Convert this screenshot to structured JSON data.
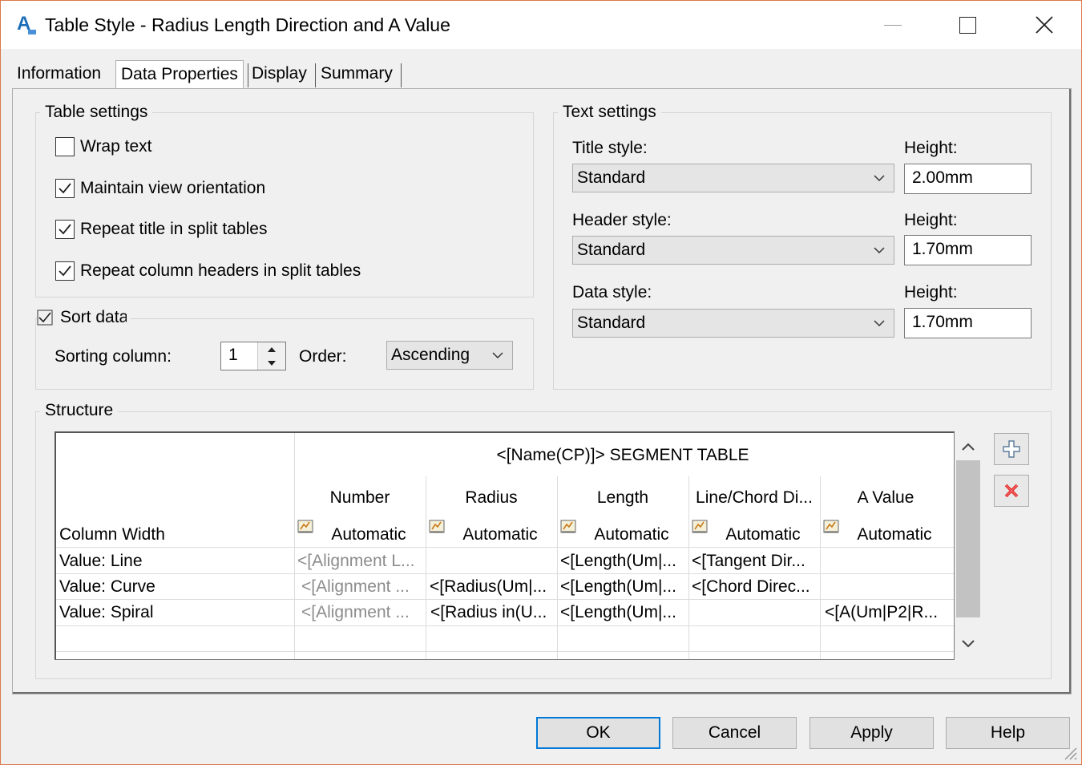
{
  "window": {
    "title": "Table Style - Radius Length Direction and A Value",
    "app_icon_letter": "A",
    "accent_border": "#d9784a"
  },
  "tabs": [
    {
      "label": "Information",
      "active": false
    },
    {
      "label": "Data Properties",
      "active": true
    },
    {
      "label": "Display",
      "active": false
    },
    {
      "label": "Summary",
      "active": false
    }
  ],
  "table_settings": {
    "label": "Table settings",
    "wrap_text": {
      "label": "Wrap text",
      "checked": false
    },
    "maintain_view": {
      "label": "Maintain view orientation",
      "checked": true
    },
    "repeat_title": {
      "label": "Repeat title in split tables",
      "checked": true
    },
    "repeat_headers": {
      "label": "Repeat column headers in split tables",
      "checked": true
    }
  },
  "sort_data": {
    "label": "Sort data",
    "checked": true,
    "sorting_column_label": "Sorting column:",
    "sorting_column_value": "1",
    "order_label": "Order:",
    "order_value": "Ascending"
  },
  "text_settings": {
    "label": "Text settings",
    "title_style_label": "Title style:",
    "title_style_value": "Standard",
    "title_height_label": "Height:",
    "title_height_value": "2.00mm",
    "header_style_label": "Header style:",
    "header_style_value": "Standard",
    "header_height_label": "Height:",
    "header_height_value": "1.70mm",
    "data_style_label": "Data style:",
    "data_style_value": "Standard",
    "data_height_label": "Height:",
    "data_height_value": "1.70mm"
  },
  "structure": {
    "label": "Structure",
    "table_title": "<[Name(CP)]> SEGMENT TABLE",
    "column_width_label": "Column Width",
    "columns": [
      {
        "name": "Number",
        "width": "Automatic"
      },
      {
        "name": "Radius",
        "width": "Automatic"
      },
      {
        "name": "Length",
        "width": "Automatic"
      },
      {
        "name": "Line/Chord Di...",
        "width": "Automatic"
      },
      {
        "name": "A Value",
        "width": "Automatic"
      }
    ],
    "rows": [
      {
        "label": "Value: Line",
        "cells": [
          "<[Alignment L...",
          "",
          "<[Length(Um|...",
          "<[Tangent Dir...",
          ""
        ]
      },
      {
        "label": "Value: Curve",
        "cells": [
          "<[Alignment ...",
          "<[Radius(Um|...",
          "<[Length(Um|...",
          "<[Chord Direc...",
          ""
        ]
      },
      {
        "label": "Value: Spiral",
        "cells": [
          "<[Alignment ...",
          "<[Radius in(U...",
          "<[Length(Um|...",
          "",
          "<[A(Um|P2|R..."
        ]
      }
    ]
  },
  "buttons": {
    "ok": "OK",
    "cancel": "Cancel",
    "apply": "Apply",
    "help": "Help"
  }
}
